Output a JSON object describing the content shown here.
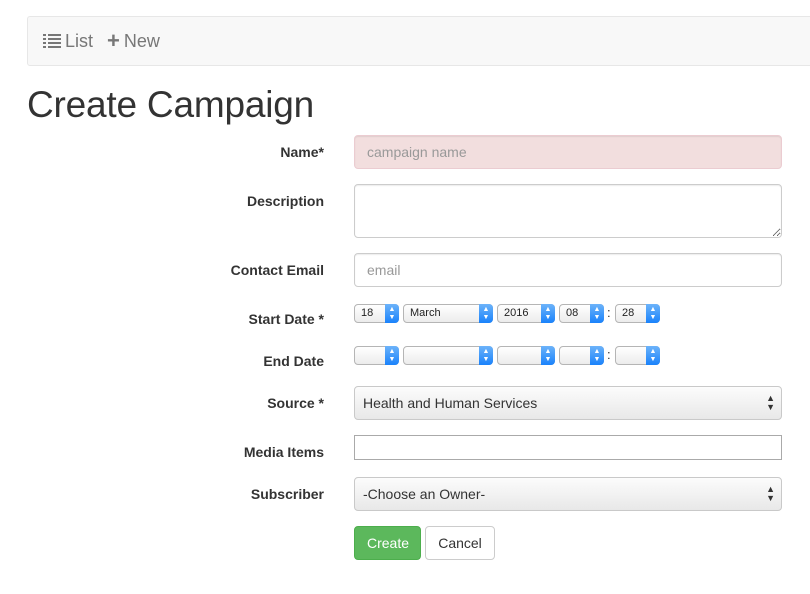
{
  "nav": {
    "list_label": "List",
    "new_label": "New"
  },
  "page_title": "Create Campaign",
  "form": {
    "name": {
      "label": "Name*",
      "placeholder": "campaign name"
    },
    "description": {
      "label": "Description"
    },
    "contact_email": {
      "label": "Contact Email",
      "placeholder": "email"
    },
    "start_date": {
      "label": "Start Date *",
      "day": "18",
      "month": "March",
      "year": "2016",
      "hour": "08",
      "minute": "28"
    },
    "end_date": {
      "label": "End Date",
      "day": "",
      "month": "",
      "year": "",
      "hour": "",
      "minute": ""
    },
    "source": {
      "label": "Source *",
      "value": "Health and Human Services"
    },
    "media_items": {
      "label": "Media Items"
    },
    "subscriber": {
      "label": "Subscriber",
      "value": "-Choose an Owner-"
    },
    "create_label": "Create",
    "cancel_label": "Cancel"
  },
  "colors": {
    "primary_green": "#5cb85c",
    "error_bg": "#f2dede",
    "mac_blue": "#1a82fb"
  }
}
